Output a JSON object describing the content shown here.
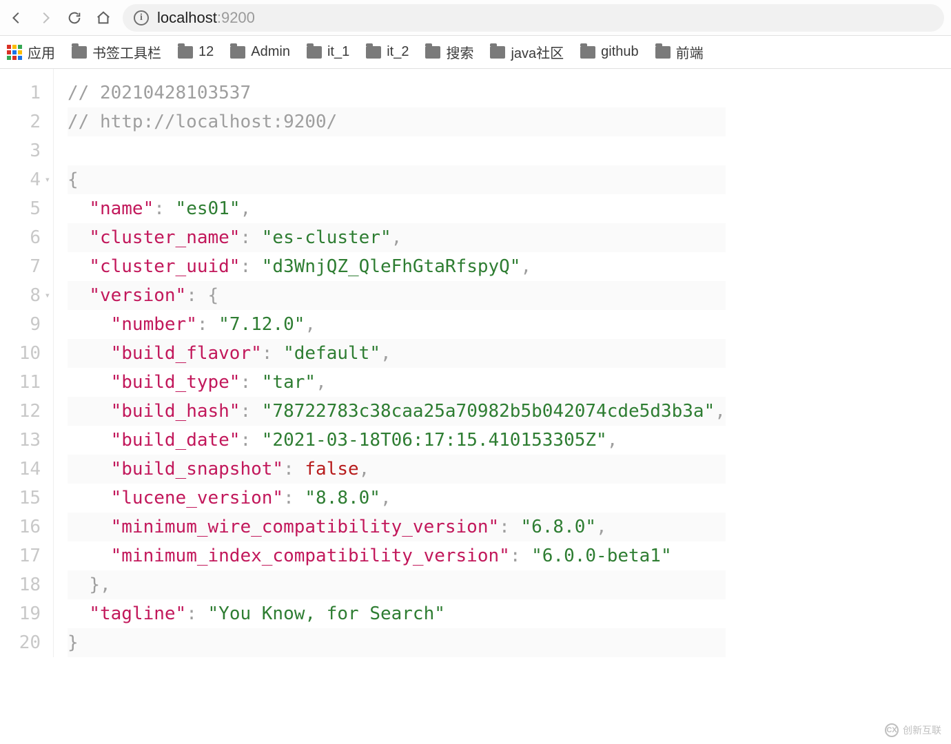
{
  "toolbar": {
    "address_host": "localhost",
    "address_port": ":9200"
  },
  "bookmarks": {
    "apps_label": "应用",
    "items": [
      {
        "label": "书签工具栏"
      },
      {
        "label": "12"
      },
      {
        "label": "Admin"
      },
      {
        "label": "it_1"
      },
      {
        "label": "it_2"
      },
      {
        "label": "搜索"
      },
      {
        "label": "java社区"
      },
      {
        "label": "github"
      },
      {
        "label": "前端"
      }
    ]
  },
  "code": {
    "line_numbers": [
      "1",
      "2",
      "3",
      "4",
      "5",
      "6",
      "7",
      "8",
      "9",
      "10",
      "11",
      "12",
      "13",
      "14",
      "15",
      "16",
      "17",
      "18",
      "19",
      "20"
    ],
    "fold_lines": [
      4,
      8
    ],
    "lines": [
      {
        "t": "comment",
        "text": "// 20210428103537"
      },
      {
        "t": "comment",
        "text": "// http://localhost:9200/"
      },
      {
        "t": "blank",
        "text": ""
      },
      {
        "t": "punc",
        "text": "{",
        "indent": 0
      },
      {
        "t": "kv",
        "indent": 1,
        "key": "name",
        "valType": "str",
        "val": "es01",
        "comma": true
      },
      {
        "t": "kv",
        "indent": 1,
        "key": "cluster_name",
        "valType": "str",
        "val": "es-cluster",
        "comma": true
      },
      {
        "t": "kv",
        "indent": 1,
        "key": "cluster_uuid",
        "valType": "str",
        "val": "d3WnjQZ_QleFhGtaRfspyQ",
        "comma": true
      },
      {
        "t": "kopen",
        "indent": 1,
        "key": "version"
      },
      {
        "t": "kv",
        "indent": 2,
        "key": "number",
        "valType": "str",
        "val": "7.12.0",
        "comma": true
      },
      {
        "t": "kv",
        "indent": 2,
        "key": "build_flavor",
        "valType": "str",
        "val": "default",
        "comma": true
      },
      {
        "t": "kv",
        "indent": 2,
        "key": "build_type",
        "valType": "str",
        "val": "tar",
        "comma": true
      },
      {
        "t": "kv",
        "indent": 2,
        "key": "build_hash",
        "valType": "str",
        "val": "78722783c38caa25a70982b5b042074cde5d3b3a",
        "comma": true
      },
      {
        "t": "kv",
        "indent": 2,
        "key": "build_date",
        "valType": "str",
        "val": "2021-03-18T06:17:15.410153305Z",
        "comma": true
      },
      {
        "t": "kv",
        "indent": 2,
        "key": "build_snapshot",
        "valType": "bool",
        "val": "false",
        "comma": true
      },
      {
        "t": "kv",
        "indent": 2,
        "key": "lucene_version",
        "valType": "str",
        "val": "8.8.0",
        "comma": true
      },
      {
        "t": "kv",
        "indent": 2,
        "key": "minimum_wire_compatibility_version",
        "valType": "str",
        "val": "6.8.0",
        "comma": true
      },
      {
        "t": "kv",
        "indent": 2,
        "key": "minimum_index_compatibility_version",
        "valType": "str",
        "val": "6.0.0-beta1",
        "comma": false
      },
      {
        "t": "close",
        "indent": 1,
        "comma": true
      },
      {
        "t": "kv",
        "indent": 1,
        "key": "tagline",
        "valType": "str",
        "val": "You Know, for Search",
        "comma": false
      },
      {
        "t": "close",
        "indent": 0,
        "comma": false
      }
    ]
  },
  "watermark": {
    "text": "创新互联"
  }
}
